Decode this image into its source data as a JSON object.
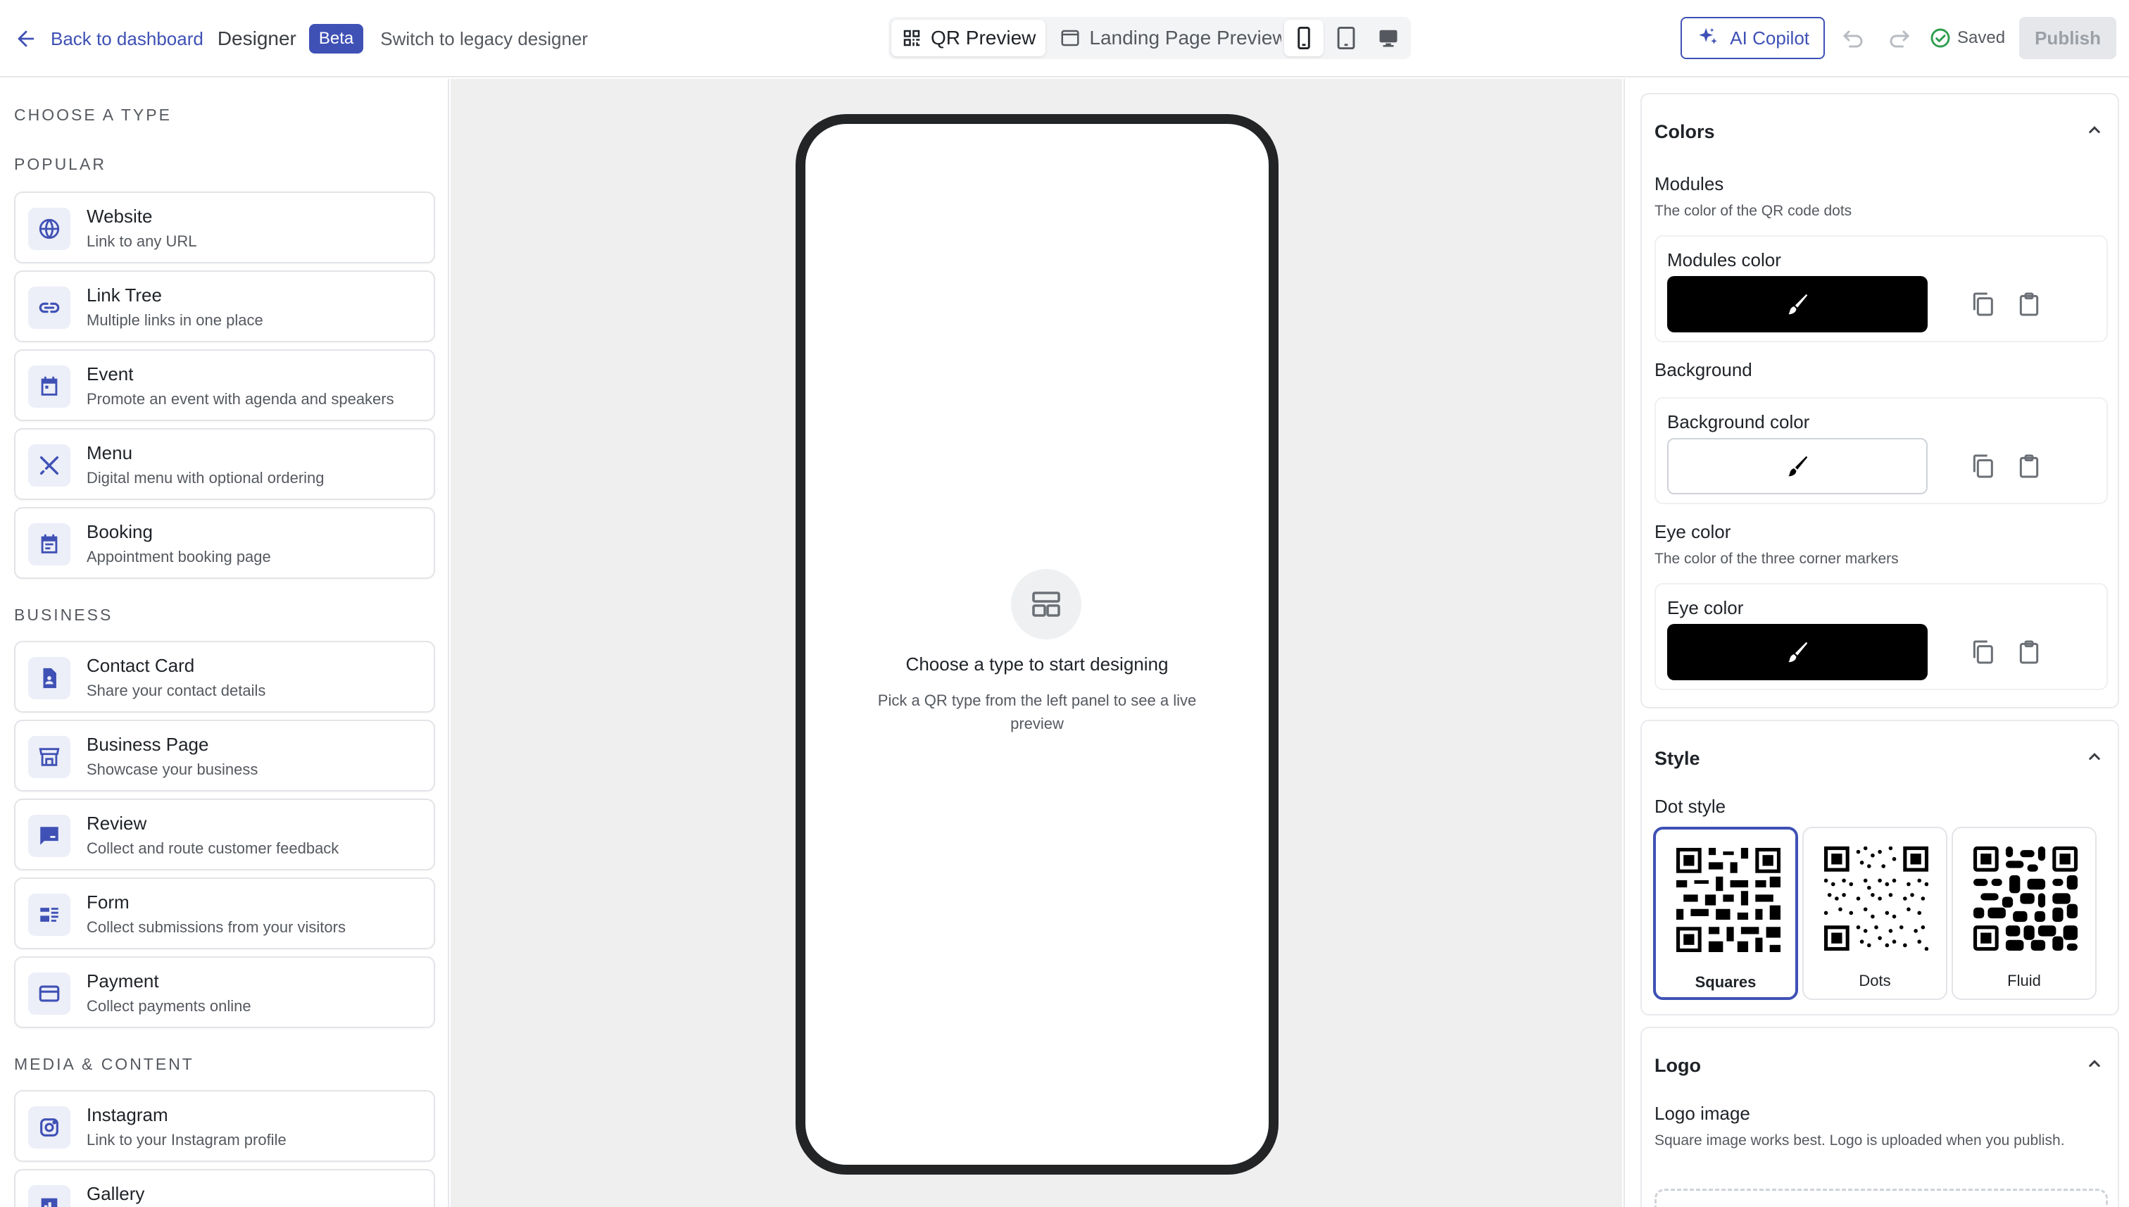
{
  "topbar": {
    "back_label": "Back to dashboard",
    "designer_label": "Designer",
    "beta_badge": "Beta",
    "legacy_link": "Switch to legacy designer",
    "preview_tabs": [
      "QR Preview",
      "Landing Page Preview"
    ],
    "active_preview": "QR Preview",
    "devices": [
      "phone-icon",
      "tablet-icon",
      "desktop-icon"
    ],
    "active_device": "phone-icon",
    "copilot_label": "AI Copilot",
    "saved_label": "Saved",
    "publish_label": "Publish"
  },
  "left_panel": {
    "title": "CHOOSE A TYPE",
    "categories": [
      {
        "name": "POPULAR",
        "items": [
          {
            "title": "Website",
            "subtitle": "Link to any URL",
            "icon": "globe-icon"
          },
          {
            "title": "Link Tree",
            "subtitle": "Multiple links in one place",
            "icon": "link-icon"
          },
          {
            "title": "Event",
            "subtitle": "Promote an event with agenda and speakers",
            "icon": "calendar-icon"
          },
          {
            "title": "Menu",
            "subtitle": "Digital menu with optional ordering",
            "icon": "utensils-icon"
          },
          {
            "title": "Booking",
            "subtitle": "Appointment booking page",
            "icon": "booking-calendar-icon"
          }
        ]
      },
      {
        "name": "BUSINESS",
        "items": [
          {
            "title": "Contact Card",
            "subtitle": "Share your contact details",
            "icon": "contact-card-icon"
          },
          {
            "title": "Business Page",
            "subtitle": "Showcase your business",
            "icon": "storefront-icon"
          },
          {
            "title": "Review",
            "subtitle": "Collect and route customer feedback",
            "icon": "review-icon"
          },
          {
            "title": "Form",
            "subtitle": "Collect submissions from your visitors",
            "icon": "form-icon"
          },
          {
            "title": "Payment",
            "subtitle": "Collect payments online",
            "icon": "credit-card-icon"
          }
        ]
      },
      {
        "name": "MEDIA & CONTENT",
        "items": [
          {
            "title": "Instagram",
            "subtitle": "Link to your Instagram profile",
            "icon": "instagram-icon"
          },
          {
            "title": "Gallery",
            "subtitle": "",
            "icon": "gallery-icon"
          }
        ]
      }
    ]
  },
  "canvas": {
    "empty_title": "Choose a type to start designing",
    "empty_subtitle": "Pick a QR type from the left panel to see a live preview"
  },
  "right_panel": {
    "colors": {
      "title": "Colors",
      "modules_title": "Modules",
      "modules_desc": "The color of the QR code dots",
      "modules_color_label": "Modules color",
      "modules_color": "#000000",
      "background_title": "Background",
      "background_color_label": "Background color",
      "background_color": "#ffffff",
      "eye_title": "Eye color",
      "eye_desc": "The color of the three corner markers",
      "eye_color_label": "Eye color",
      "eye_color": "#000000"
    },
    "style": {
      "title": "Style",
      "dot_style_label": "Dot style",
      "options": [
        "Squares",
        "Dots",
        "Fluid"
      ],
      "selected": "Squares"
    },
    "logo": {
      "title": "Logo",
      "image_label": "Logo image",
      "image_desc": "Square image works best. Logo is uploaded when you publish."
    }
  },
  "accent_color": "#3f51b5"
}
